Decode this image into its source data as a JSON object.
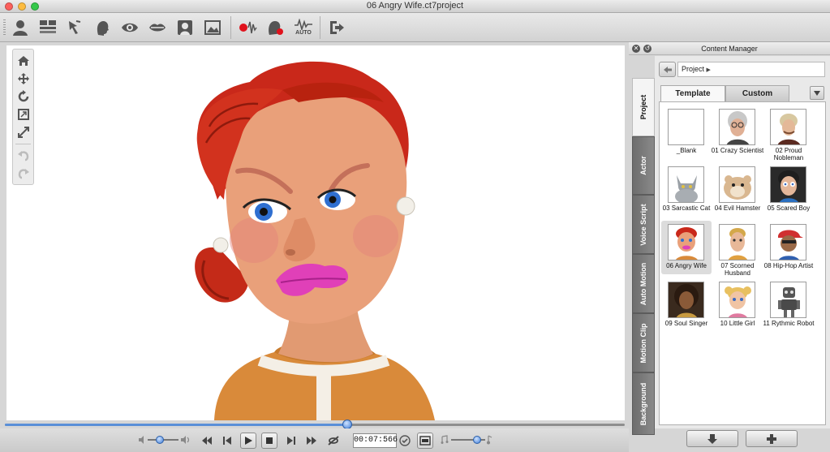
{
  "window": {
    "title": "06 Angry Wife.ct7project"
  },
  "toolbar": {
    "icons": [
      "actor-icon",
      "composer-icon",
      "gesture-icon",
      "head-icon",
      "eye-icon",
      "lips-icon",
      "face-frame-icon",
      "background-image-icon",
      "record-audio-icon",
      "record-face-icon",
      "auto-motion-icon",
      "export-icon"
    ],
    "auto_label": "AUTO"
  },
  "view_tools": [
    "home-icon",
    "move-icon",
    "rotate-icon",
    "fit-icon",
    "maximize-icon",
    "undo-icon",
    "redo-icon"
  ],
  "playback": {
    "timecode": "00:07:566",
    "timeline_progress": 0.553,
    "volume_level": 0.4,
    "speed_level": 0.75
  },
  "content_manager": {
    "title": "Content Manager",
    "breadcrumb": "Project",
    "tabs": [
      {
        "label": "Template",
        "active": true
      },
      {
        "label": "Custom",
        "active": false
      }
    ],
    "side_tabs": [
      {
        "label": "Project",
        "active": true
      },
      {
        "label": "Actor",
        "active": false
      },
      {
        "label": "Voice Script",
        "active": false
      },
      {
        "label": "Auto Motion",
        "active": false
      },
      {
        "label": "Motion Clip",
        "active": false
      },
      {
        "label": "Background",
        "active": false
      }
    ],
    "items": [
      {
        "label": "_Blank",
        "selected": false
      },
      {
        "label": "01 Crazy Scientist",
        "selected": false
      },
      {
        "label": "02 Proud Nobleman",
        "selected": false
      },
      {
        "label": "03 Sarcastic Cat",
        "selected": false
      },
      {
        "label": "04 Evil Hamster",
        "selected": false
      },
      {
        "label": "05 Scared Boy",
        "selected": false
      },
      {
        "label": "06 Angry Wife",
        "selected": true
      },
      {
        "label": "07 Scorned Husband",
        "selected": false
      },
      {
        "label": "08 Hip-Hop Artist",
        "selected": false
      },
      {
        "label": "09 Soul Singer",
        "selected": false
      },
      {
        "label": "10 Little Girl",
        "selected": false
      },
      {
        "label": "11 Rythmic Robot",
        "selected": false
      }
    ],
    "actions": [
      "download-icon",
      "add-icon"
    ]
  },
  "colors": {
    "accent": "#3d7bd6",
    "hair": "#c9281a",
    "skin": "#e9a07a",
    "lips": "#e040b8",
    "shirt": "#d98a3a",
    "record": "#e0121c"
  }
}
